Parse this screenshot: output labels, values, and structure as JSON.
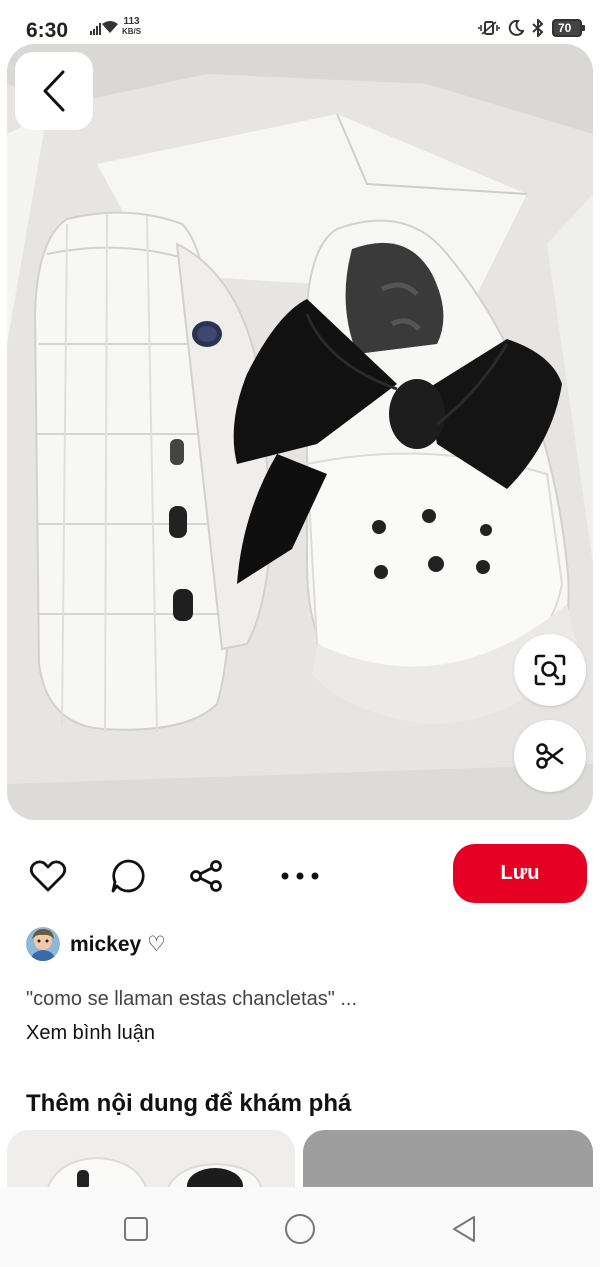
{
  "status_bar": {
    "time": "6:30",
    "net_speed_value": "113",
    "net_speed_unit": "KB/S",
    "battery": "70"
  },
  "pin": {
    "image_subject": "white platform clogs with black bow in a gift box",
    "back_icon": "chevron-left-icon",
    "visual_search_icon": "lens-search-icon",
    "crop_icon": "scissors-icon"
  },
  "actions": {
    "like_icon": "heart-icon",
    "comment_icon": "comment-bubble-icon",
    "share_icon": "share-icon",
    "more_icon": "more-dots-icon",
    "save_label": "Lưu"
  },
  "creator": {
    "name": "mickey ♡"
  },
  "description": "\"como se llaman estas chancletas\" ...",
  "view_comments": "Xem bình luận",
  "more_to_explore": "Thêm nội dung để khám phá",
  "colors": {
    "save_button": "#e60023",
    "text_primary": "#111111",
    "text_secondary": "#444444"
  }
}
